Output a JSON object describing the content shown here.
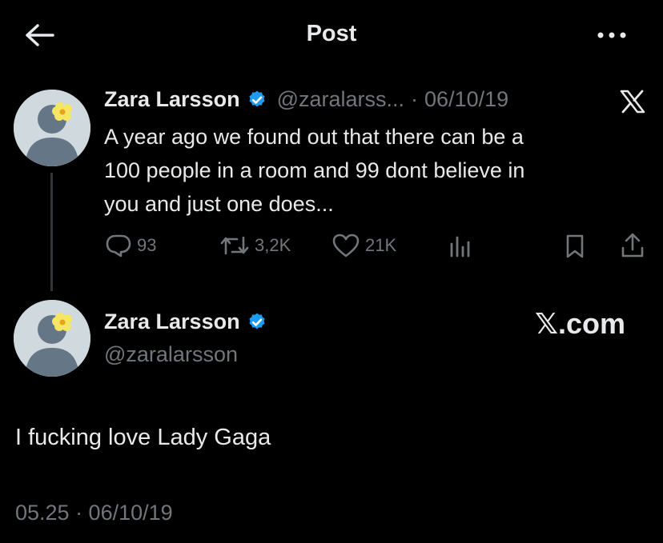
{
  "header": {
    "title": "Post",
    "back_icon": "arrow-left-icon",
    "more_icon": "more-dots-icon"
  },
  "quoted_post": {
    "name": "Zara Larsson",
    "handle": "@zaralarss...",
    "separator": "·",
    "date": "06/10/19",
    "text_lines": [
      "A year ago we found out that there can be a",
      "100 people in a room and 99 dont believe in",
      "you and just one does..."
    ],
    "replies": "93",
    "reposts": "3,2K",
    "likes": "21K",
    "platform_icon": "x-logo-icon"
  },
  "main_post": {
    "name": "Zara Larsson",
    "handle": "@zaralarsson",
    "brand": "𝕏.com",
    "text": "I fucking love Lady Gaga",
    "timestamp": "05.25 · 06/10/19"
  },
  "colors": {
    "background": "#000000",
    "text": "#e7e9ea",
    "muted": "#71767b",
    "verified": "#1d9bf0",
    "flower": "#f5e663"
  }
}
